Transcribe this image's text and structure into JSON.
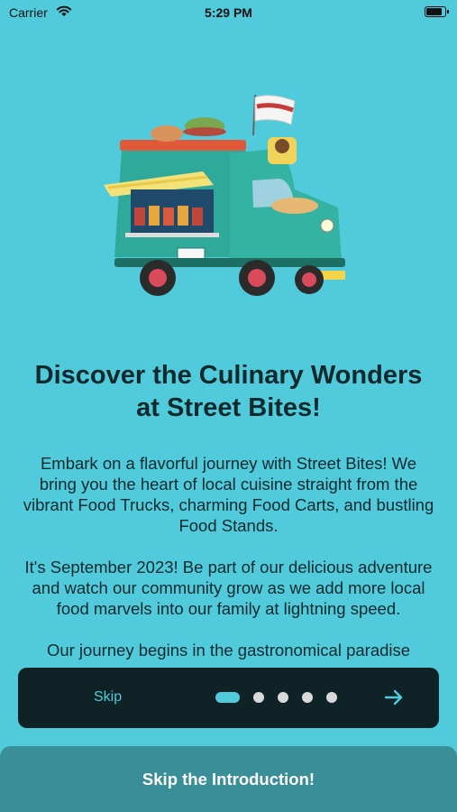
{
  "status_bar": {
    "carrier": "Carrier",
    "time": "5:29 PM",
    "battery_level": 0.9
  },
  "hero": {
    "image": "food-truck-illustration"
  },
  "content": {
    "title": "Discover the Culinary Wonders at Street Bites!",
    "paragraphs": [
      "Embark on a flavorful journey with Street Bites! We bring you the heart of local cuisine straight from the vibrant Food Trucks, charming Food Carts, and bustling Food Stands.",
      "It's September 2023! Be part of our delicious adventure and watch our community grow as we add more local food marvels into our family at lightning speed.",
      "Our journey begins in the gastronomical paradise"
    ]
  },
  "pager": {
    "skip_label": "Skip",
    "page_count": 5,
    "current_page": 1,
    "next_icon": "arrow-right-icon"
  },
  "cta": {
    "label": "Skip the Introduction!"
  },
  "colors": {
    "background": "#51cadc",
    "accent": "#51cadc",
    "pager_bg": "#0f2326",
    "cta_bg": "#3a8e98"
  }
}
